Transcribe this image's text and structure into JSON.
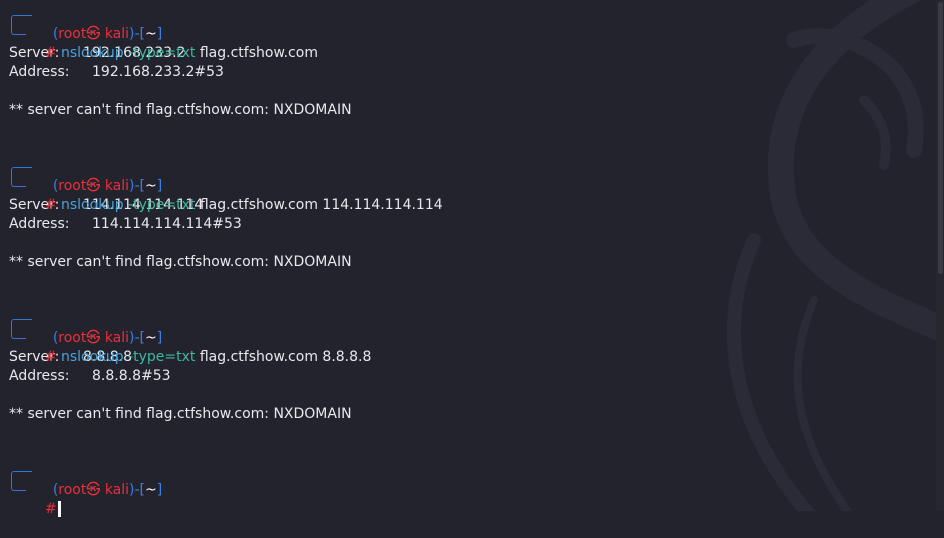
{
  "prompt": {
    "user": "root",
    "at_symbol": "㉿",
    "host": "kali",
    "dir": "~",
    "hash": "#"
  },
  "blocks": [
    {
      "cmd": "nslookup",
      "opt": "-type=txt",
      "args": "flag.ctfshow.com",
      "server_label": "Server:",
      "server": "192.168.233.2",
      "address_label": "Address:",
      "address": "192.168.233.2#53",
      "error": "** server can't find flag.ctfshow.com: NXDOMAIN"
    },
    {
      "cmd": "nslookup",
      "opt": "-type=txt",
      "args": "flag.ctfshow.com 114.114.114.114",
      "server_label": "Server:",
      "server": "114.114.114.114",
      "address_label": "Address:",
      "address": "114.114.114.114#53",
      "error": "** server can't find flag.ctfshow.com: NXDOMAIN"
    },
    {
      "cmd": "nslookup",
      "opt": "-type=txt",
      "args": "flag.ctfshow.com 8.8.8.8",
      "server_label": "Server:",
      "server": "8.8.8.8",
      "address_label": "Address:",
      "address": "8.8.8.8#53",
      "error": "** server can't find flag.ctfshow.com: NXDOMAIN"
    }
  ],
  "icons": {
    "background": "kali-dragon-icon"
  },
  "colors": {
    "background": "#22232c",
    "prompt_red": "#e8303b",
    "prompt_blue": "#3d7fe0",
    "command": "#4aa3d9",
    "option": "#3fb8a3",
    "text": "#e8e8ec"
  }
}
